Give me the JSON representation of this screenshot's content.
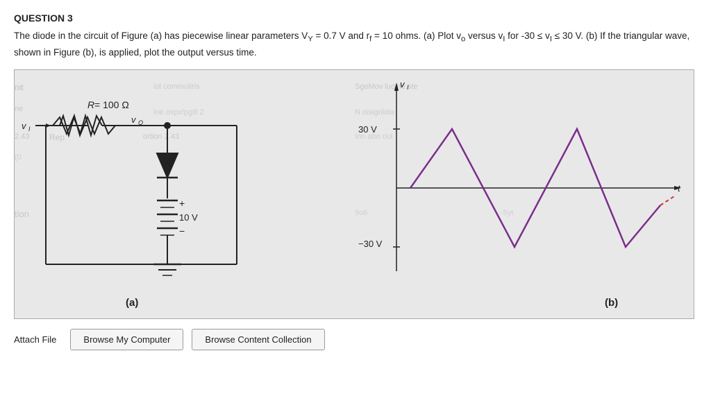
{
  "page": {
    "question_title": "QUESTION 3",
    "question_text": "The diode in the circuit of Figure (a) has piecewise linear parameters V",
    "question_subscript_y": "Y",
    "question_text2": " = 0.7 V and r",
    "question_subscript_f": "f",
    "question_text3": " = 10 ohms. (a) Plot v",
    "question_subscript_o": "o",
    "question_text4": " versus v",
    "question_subscript_i": "I",
    "question_text5": " for -30 ≤ v",
    "question_subscript_i2": "I",
    "question_text6": " ≤ 30 V. (b) If the triangular wave, shown in Figure (b), is applied, plot the output versus time.",
    "circuit": {
      "R_label": "R = 100 Ω",
      "vI_label": "v_I",
      "vO_label": "v_O",
      "battery_label": "10 V",
      "plus_label": "+",
      "minus_label": "−",
      "subfig_label": "(a)"
    },
    "graph": {
      "y_max_label": "30 V",
      "y_min_label": "−30 V",
      "vI_axis_label": "v_I",
      "t_label": "t",
      "subfig_label": "(b)"
    },
    "attach": {
      "label": "Attach File",
      "browse_computer": "Browse My Computer",
      "browse_collection": "Browse Content Collection"
    }
  }
}
